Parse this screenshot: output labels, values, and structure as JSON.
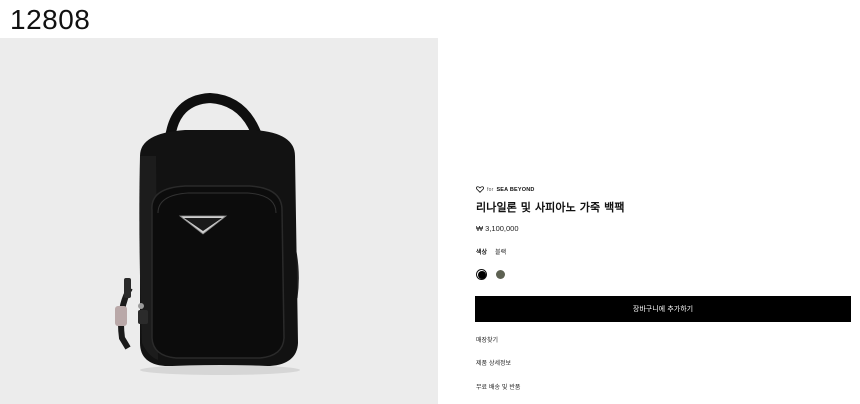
{
  "page": {
    "id_label": "12808"
  },
  "product": {
    "brand_prefix": "for",
    "brand_name": "SEA BEYOND",
    "name": "리나일론 및 사피아노 가죽 백팩",
    "price": "₩ 3,100,000",
    "color_label": "색상",
    "color_value": "블랙",
    "swatches": [
      {
        "name": "black",
        "color": "#000000",
        "selected": true
      },
      {
        "name": "olive",
        "color": "#5d6152",
        "selected": false
      }
    ],
    "image_alt": "black nylon backpack with triangle logo"
  },
  "actions": {
    "add_to_cart_label": "장바구니에 추가하기",
    "store_link_label": "매장찾기",
    "details_link_label": "제품 상세정보",
    "shipping_link_label": "무료 배송 및 반품"
  },
  "colors": {
    "background": "#ffffff",
    "image_background": "#ececec",
    "button_background": "#000000",
    "button_text": "#ffffff"
  }
}
